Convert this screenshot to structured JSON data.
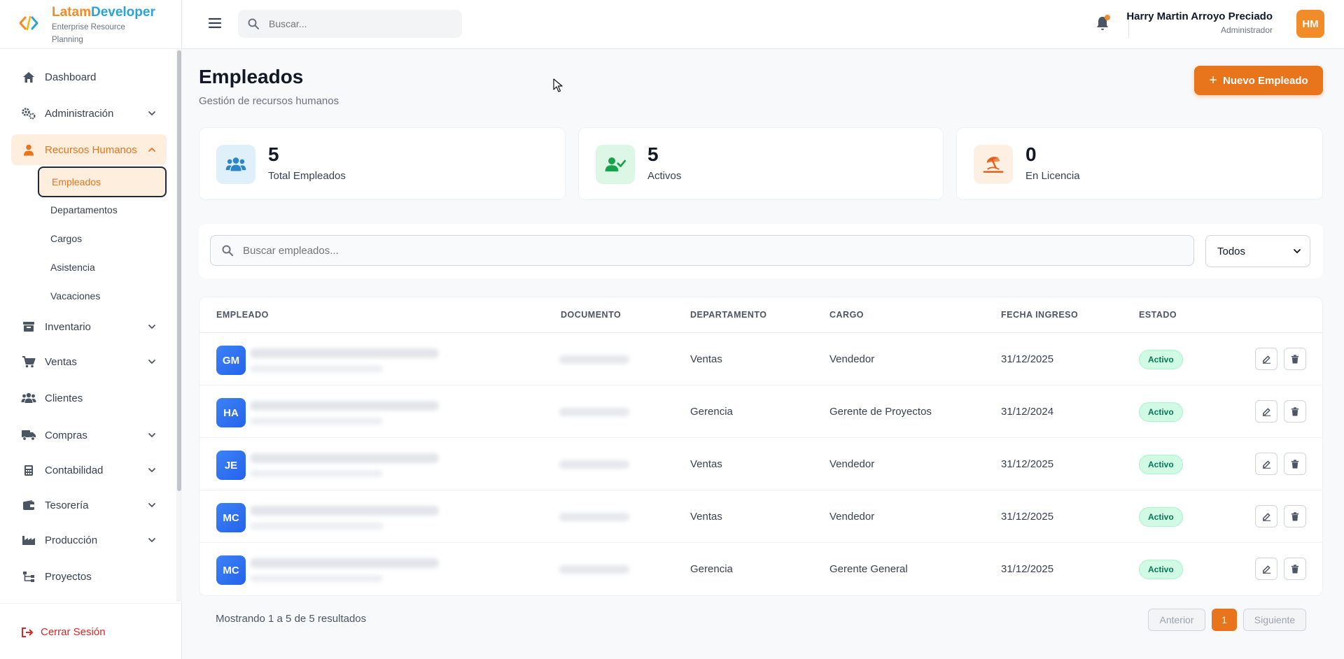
{
  "brand": {
    "name_part1": "Latam",
    "name_part2": "Developer",
    "subtitle": "Enterprise Resource Planning"
  },
  "sidebar": {
    "items": [
      {
        "label": "Dashboard",
        "icon": "home-icon"
      },
      {
        "label": "Administración",
        "icon": "gears-icon"
      },
      {
        "label": "Recursos Humanos",
        "icon": "user-icon"
      },
      {
        "label": "Inventario",
        "icon": "warehouse-icon"
      },
      {
        "label": "Ventas",
        "icon": "cart-icon"
      },
      {
        "label": "Clientes",
        "icon": "users-icon"
      },
      {
        "label": "Compras",
        "icon": "truck-icon"
      },
      {
        "label": "Contabilidad",
        "icon": "calculator-icon"
      },
      {
        "label": "Tesorería",
        "icon": "wallet-icon"
      },
      {
        "label": "Producción",
        "icon": "industry-icon"
      },
      {
        "label": "Proyectos",
        "icon": "sitemap-icon"
      }
    ],
    "submenu": [
      "Empleados",
      "Departamentos",
      "Cargos",
      "Asistencia",
      "Vacaciones"
    ],
    "logout": "Cerrar Sesión"
  },
  "topbar": {
    "search_placeholder": "Buscar...",
    "user_name": "Harry Martin Arroyo Preciado",
    "user_role": "Administrador",
    "user_initials": "HM"
  },
  "page": {
    "title": "Empleados",
    "subtitle": "Gestión de recursos humanos",
    "new_button": "Nuevo Empleado"
  },
  "stats": [
    {
      "value": "5",
      "label": "Total Empleados"
    },
    {
      "value": "5",
      "label": "Activos"
    },
    {
      "value": "0",
      "label": "En Licencia"
    }
  ],
  "filters": {
    "search_placeholder": "Buscar empleados...",
    "status_selected": "Todos"
  },
  "table": {
    "headers": [
      "EMPLEADO",
      "DOCUMENTO",
      "DEPARTAMENTO",
      "CARGO",
      "FECHA INGRESO",
      "ESTADO"
    ],
    "rows": [
      {
        "initials": "GM",
        "departamento": "Ventas",
        "cargo": "Vendedor",
        "fecha": "31/12/2025",
        "estado": "Activo"
      },
      {
        "initials": "HA",
        "departamento": "Gerencia",
        "cargo": "Gerente de Proyectos",
        "fecha": "31/12/2024",
        "estado": "Activo"
      },
      {
        "initials": "JE",
        "departamento": "Ventas",
        "cargo": "Vendedor",
        "fecha": "31/12/2025",
        "estado": "Activo"
      },
      {
        "initials": "MC",
        "departamento": "Ventas",
        "cargo": "Vendedor",
        "fecha": "31/12/2025",
        "estado": "Activo"
      },
      {
        "initials": "MC",
        "departamento": "Gerencia",
        "cargo": "Gerente General",
        "fecha": "31/12/2025",
        "estado": "Activo"
      }
    ]
  },
  "pagination": {
    "summary": "Mostrando 1 a 5 de 5 resultados",
    "prev": "Anterior",
    "current": "1",
    "next": "Siguiente"
  },
  "colors": {
    "accent": "#e8741c",
    "brand_orange": "#f28c28",
    "brand_blue": "#2aa3d9",
    "active_badge": "#d1fae5"
  }
}
